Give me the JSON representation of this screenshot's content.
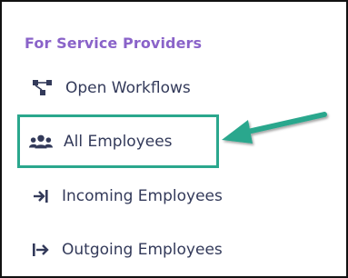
{
  "section": {
    "title": "For Service Providers"
  },
  "nav": {
    "items": [
      {
        "label": "Open Workflows",
        "icon": "workflow-icon"
      },
      {
        "label": "All Employees",
        "icon": "users-icon"
      },
      {
        "label": "Incoming Employees",
        "icon": "arrow-into-bar-icon"
      },
      {
        "label": "Outgoing Employees",
        "icon": "arrow-from-bar-icon"
      }
    ]
  },
  "colors": {
    "section_title": "#8a63c9",
    "nav_text": "#333a5a",
    "highlight": "#2aa78d"
  }
}
